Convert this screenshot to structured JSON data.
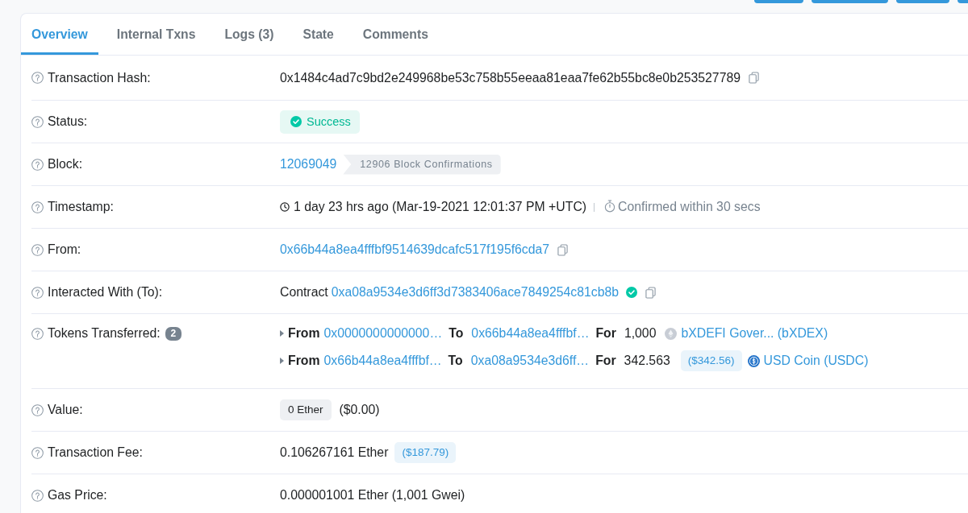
{
  "tabs": [
    {
      "label": "Overview",
      "selected": true
    },
    {
      "label": "Internal Txns",
      "selected": false
    },
    {
      "label": "Logs (3)",
      "selected": false
    },
    {
      "label": "State",
      "selected": false
    },
    {
      "label": "Comments",
      "selected": false
    }
  ],
  "rows": [
    {
      "kind": "hash",
      "label": "Transaction Hash:",
      "value": "0x1484c4ad7c9bd2e249968be53c758b55eeaa81eaa7fe62b55bc8e0b253527789",
      "copy": true
    },
    {
      "kind": "status",
      "label": "Status:",
      "value": "Success"
    },
    {
      "kind": "block",
      "label": "Block:",
      "value": "12069049",
      "confirmations": "12906 Block Confirmations"
    },
    {
      "kind": "timestamp",
      "label": "Timestamp:",
      "value": "1 day 23 hrs ago (Mar-19-2021 12:01:37 PM +UTC)",
      "note": "Confirmed within 30 secs"
    },
    {
      "kind": "address",
      "label": "From:",
      "value": "0x66b44a8ea4fffbf9514639dcafc517f195f6cda7",
      "copy": true
    },
    {
      "kind": "contract",
      "label": "Interacted With (To):",
      "prefix": "Contract",
      "value": "0xa08a9534e3d6ff3d7383406ace7849254c81cb8b",
      "verified": true,
      "copy": true
    },
    {
      "kind": "transfers",
      "label": "Tokens Transferred:",
      "count": "2",
      "transfers": [
        {
          "kind": "default",
          "from_label": "From",
          "from": "0x0000000000000…",
          "to_label": "To",
          "to": "0x66b44a8ea4fffbf…",
          "for_label": "For",
          "amount": "1,000",
          "token": "bXDEFI Gover... (bXDEX)"
        },
        {
          "kind": "dollar",
          "from_label": "From",
          "from": "0x66b44a8ea4fffbf…",
          "to_label": "To",
          "to": "0xa08a9534e3d6ff…",
          "for_label": "For",
          "amount": "342.563",
          "usd": "($342.56)",
          "token": "USD Coin (USDC)"
        }
      ]
    },
    {
      "kind": "value",
      "label": "Value:",
      "value": "0 Ether",
      "usd": "($0.00)"
    },
    {
      "kind": "fee",
      "label": "Transaction Fee:",
      "value": "0.106267161 Ether",
      "usd": "($187.79)"
    },
    {
      "kind": "plain",
      "label": "Gas Price:",
      "value": "0.000001001 Ether (1,001 Gwei)"
    }
  ]
}
